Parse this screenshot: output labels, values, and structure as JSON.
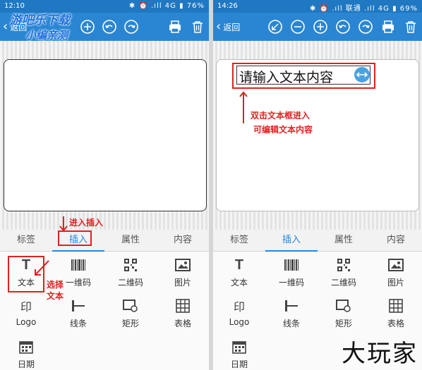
{
  "left": {
    "status": {
      "time": "12:10",
      "icons": "✱ ⏰ .ıll 4G ▮ 76%"
    },
    "back_label": "返回",
    "tabs": [
      "标签",
      "插入",
      "属性",
      "内容"
    ],
    "tools": [
      "文本",
      "一维码",
      "二维码",
      "图片",
      "Logo",
      "线条",
      "矩形",
      "表格",
      "日期"
    ],
    "watermark": {
      "line1": "游吧乐下载",
      "line2": "小编亲测"
    },
    "annotations": {
      "insert_tip": "进入插入",
      "select_text_l1": "选择",
      "select_text_l2": "文本"
    }
  },
  "right": {
    "status": {
      "time": "14:26",
      "icons": "✱ ⏰ .ıll 联通 .ıll 4G ▮ 69%"
    },
    "back_label": "返回",
    "tabs": [
      "标签",
      "插入",
      "属性",
      "内容"
    ],
    "tools": [
      "文本",
      "一维码",
      "二维码",
      "图片",
      "Logo",
      "线条",
      "矩形",
      "表格",
      "日期"
    ],
    "textbox_placeholder": "请输入文本内容",
    "annotations": {
      "edit_tip_l1": "双击文本框进入",
      "edit_tip_l2": "可编辑文本内容"
    },
    "site_logo": "大玩家"
  },
  "colors": {
    "accent": "#1e88e5",
    "toolbar": "#2a86d2",
    "annotation": "#e02020"
  },
  "icons": [
    "back-chevron-icon",
    "rotate-icon",
    "zoom-out-icon",
    "zoom-in-icon",
    "undo-icon",
    "redo-icon",
    "print-icon",
    "delete-icon"
  ]
}
